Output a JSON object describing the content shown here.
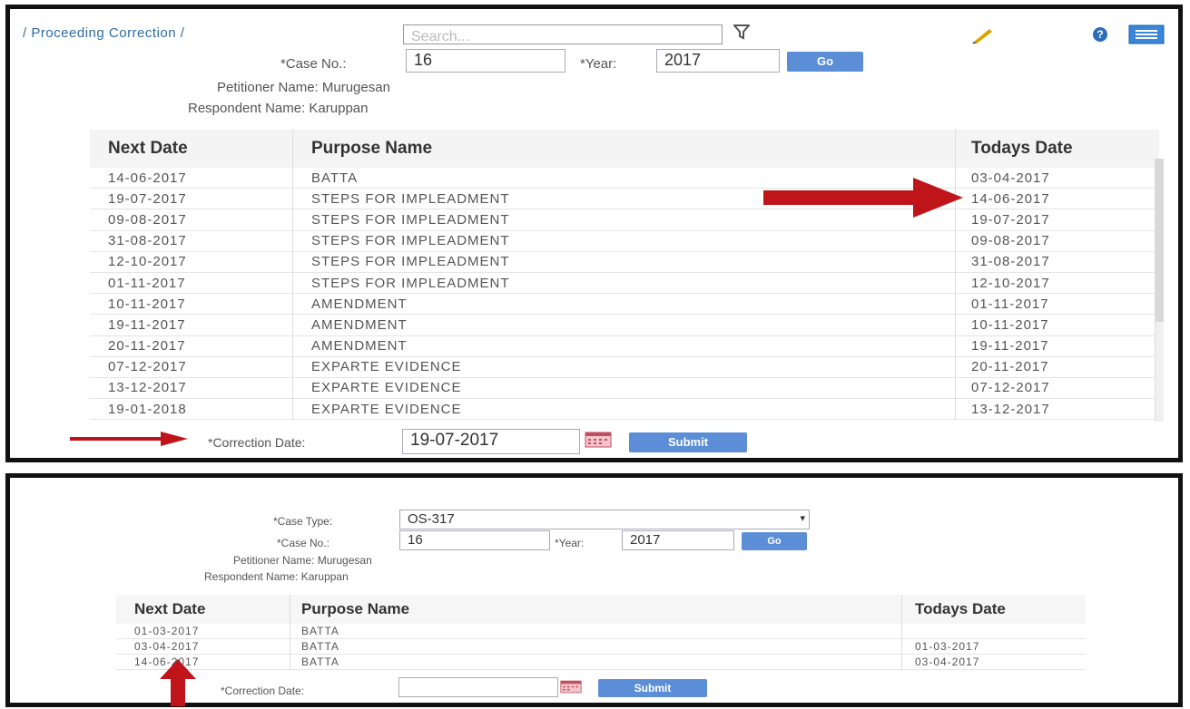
{
  "top_panel": {
    "breadcrumb": "/ Proceeding Correction /",
    "search_placeholder": "Search...",
    "case_no_label": "*Case No.:",
    "case_no_value": "16",
    "year_label": "*Year:",
    "year_value": "2017",
    "go_label": "Go",
    "petitioner": "Petitioner Name: Murugesan",
    "respondent": "Respondent Name: Karuppan",
    "columns": [
      "Next Date",
      "Purpose Name",
      "Todays Date"
    ],
    "rows": [
      {
        "next": "14-06-2017",
        "purpose": "BATTA",
        "today": "03-04-2017"
      },
      {
        "next": "19-07-2017",
        "purpose": "STEPS FOR IMPLEADMENT",
        "today": "14-06-2017"
      },
      {
        "next": "09-08-2017",
        "purpose": "STEPS FOR IMPLEADMENT",
        "today": "19-07-2017"
      },
      {
        "next": "31-08-2017",
        "purpose": "STEPS FOR IMPLEADMENT",
        "today": "09-08-2017"
      },
      {
        "next": "12-10-2017",
        "purpose": "STEPS FOR IMPLEADMENT",
        "today": "31-08-2017"
      },
      {
        "next": "01-11-2017",
        "purpose": "STEPS FOR IMPLEADMENT",
        "today": "12-10-2017"
      },
      {
        "next": "10-11-2017",
        "purpose": "AMENDMENT",
        "today": "01-11-2017"
      },
      {
        "next": "19-11-2017",
        "purpose": "AMENDMENT",
        "today": "10-11-2017"
      },
      {
        "next": "20-11-2017",
        "purpose": "AMENDMENT",
        "today": "19-11-2017"
      },
      {
        "next": "07-12-2017",
        "purpose": "EXPARTE EVIDENCE",
        "today": "20-11-2017"
      },
      {
        "next": "13-12-2017",
        "purpose": "EXPARTE EVIDENCE",
        "today": "07-12-2017"
      },
      {
        "next": "19-01-2018",
        "purpose": "EXPARTE EVIDENCE",
        "today": "13-12-2017"
      }
    ],
    "correction_label": "*Correction Date:",
    "correction_value": "19-07-2017",
    "submit_label": "Submit"
  },
  "bottom_panel": {
    "case_type_label": "*Case Type:",
    "case_type_value": "OS-317",
    "case_no_label": "*Case No.:",
    "case_no_value": "16",
    "year_label": "*Year:",
    "year_value": "2017",
    "go_label": "Go",
    "petitioner": "Petitioner Name: Murugesan",
    "respondent": "Respondent Name: Karuppan",
    "columns": [
      "Next Date",
      "Purpose Name",
      "Todays Date"
    ],
    "rows": [
      {
        "next": "01-03-2017",
        "purpose": "BATTA",
        "today": ""
      },
      {
        "next": "03-04-2017",
        "purpose": "BATTA",
        "today": "01-03-2017"
      },
      {
        "next": "14-06-2017",
        "purpose": "BATTA",
        "today": "03-04-2017"
      }
    ],
    "correction_label": "*Correction Date:",
    "correction_value": "",
    "submit_label": "Submit"
  },
  "colors": {
    "button": "#5b8ed6",
    "arrow": "#c0141b",
    "link": "#2e6da4"
  },
  "icons": [
    "filter-icon",
    "pencil-icon",
    "help-icon",
    "menu-icon",
    "calendar-icon",
    "arrow-icon"
  ]
}
